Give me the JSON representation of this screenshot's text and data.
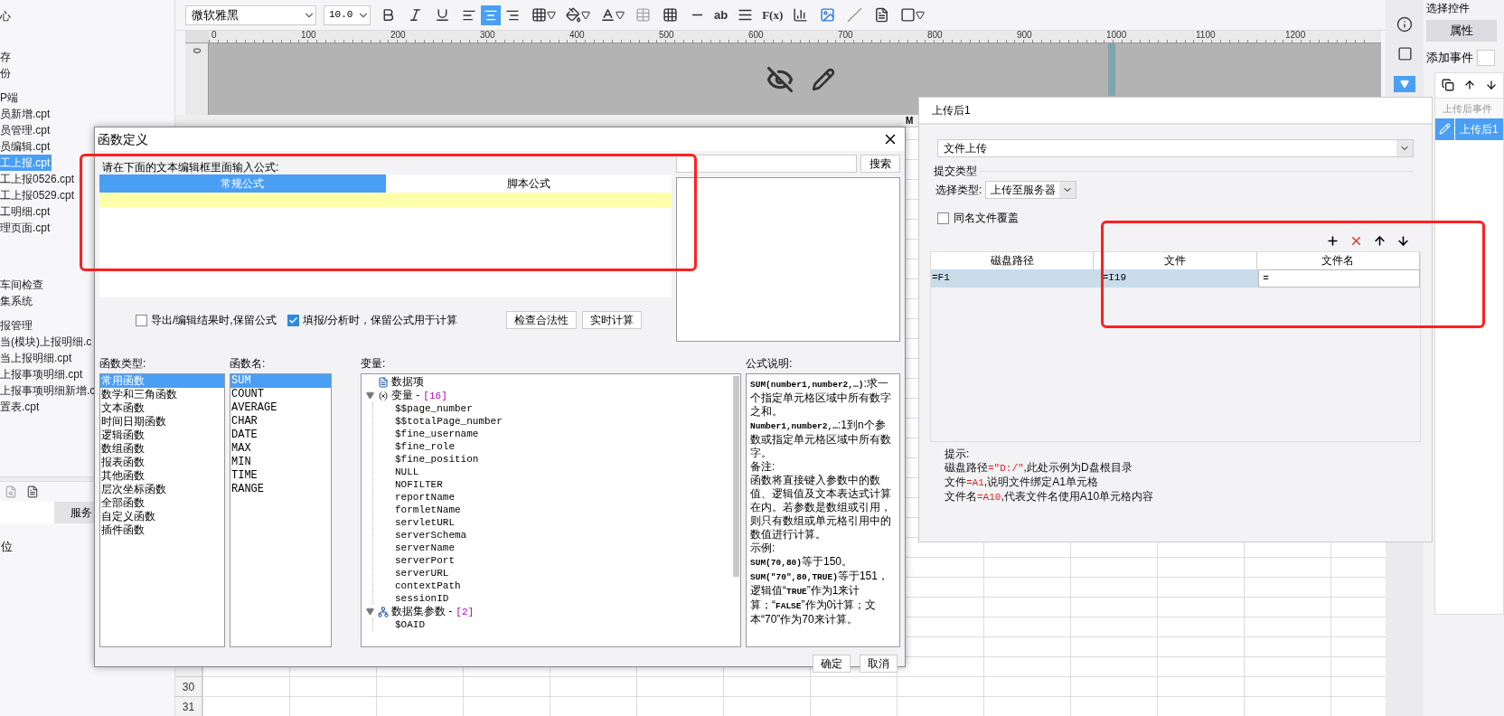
{
  "toolbar": {
    "font": "微软雅黑",
    "size": "10.0",
    "align_buttons": [
      {
        "selected": false
      },
      {
        "selected": true
      },
      {
        "selected": false
      }
    ],
    "text_icon_label": "ab",
    "formula_label": "F(x)"
  },
  "ruler": {
    "vertical_label": "0",
    "labels": [
      "0",
      "100",
      "200",
      "300",
      "400",
      "500",
      "600",
      "700",
      "800",
      "900",
      "1000",
      "1100",
      "1200"
    ]
  },
  "left_panel": {
    "groups": [
      [
        {
          "text": "心",
          "selected": false
        }
      ],
      [
        {
          "text": "存",
          "selected": false
        },
        {
          "text": "份",
          "selected": false
        }
      ],
      [
        {
          "text": "P端",
          "selected": false
        },
        {
          "text": "员新增.cpt",
          "selected": false
        },
        {
          "text": "员管理.cpt",
          "selected": false
        },
        {
          "text": "员编辑.cpt",
          "selected": false
        },
        {
          "text": "工上报.cpt",
          "selected": true
        },
        {
          "text": "工上报0526.cpt",
          "selected": false
        },
        {
          "text": "工上报0529.cpt",
          "selected": false
        },
        {
          "text": "工明细.cpt",
          "selected": false
        },
        {
          "text": "理页面.cpt",
          "selected": false
        }
      ],
      [
        {
          "text": "车间检查",
          "selected": false
        },
        {
          "text": "集系统",
          "selected": false
        }
      ],
      [
        {
          "text": "报管理",
          "selected": false
        },
        {
          "text": "当(模块)上报明细.c",
          "selected": false
        },
        {
          "text": "当上报明细.cpt",
          "selected": false
        },
        {
          "text": "上报事项明细.cpt",
          "selected": false
        },
        {
          "text": "上报事项明细新增.c",
          "selected": false
        },
        {
          "text": "置表.cpt",
          "selected": false
        }
      ]
    ],
    "tab": "服务",
    "bottom_item": "位"
  },
  "grid": {
    "column_label": "M",
    "rows": [
      "30",
      "31"
    ]
  },
  "function_dialog": {
    "title": "函数定义",
    "prompt": "请在下面的文本编辑框里面输入公式:",
    "tabs": [
      {
        "label": "常规公式",
        "selected": true
      },
      {
        "label": "脚本公式",
        "selected": false
      }
    ],
    "search_button": "搜索",
    "options": [
      {
        "label": "导出/编辑结果时,保留公式",
        "checked": false
      },
      {
        "label": "填报/分析时，保留公式用于计算",
        "checked": true
      }
    ],
    "action_buttons": [
      "检查合法性",
      "实时计算"
    ],
    "type_label": "函数类型:",
    "types": [
      {
        "text": "常用函数",
        "selected": true
      },
      {
        "text": "数学和三角函数",
        "selected": false
      },
      {
        "text": "文本函数",
        "selected": false
      },
      {
        "text": "时间日期函数",
        "selected": false
      },
      {
        "text": "逻辑函数",
        "selected": false
      },
      {
        "text": "数组函数",
        "selected": false
      },
      {
        "text": "报表函数",
        "selected": false
      },
      {
        "text": "其他函数",
        "selected": false
      },
      {
        "text": "层次坐标函数",
        "selected": false
      },
      {
        "text": "全部函数",
        "selected": false
      },
      {
        "text": "自定义函数",
        "selected": false
      },
      {
        "text": "插件函数",
        "selected": false
      }
    ],
    "name_label": "函数名:",
    "names": [
      {
        "text": "SUM",
        "selected": true
      },
      {
        "text": "COUNT",
        "selected": false
      },
      {
        "text": "AVERAGE",
        "selected": false
      },
      {
        "text": "CHAR",
        "selected": false
      },
      {
        "text": "DATE",
        "selected": false
      },
      {
        "text": "MAX",
        "selected": false
      },
      {
        "text": "MIN",
        "selected": false
      },
      {
        "text": "TIME",
        "selected": false
      },
      {
        "text": "RANGE",
        "selected": false
      }
    ],
    "var_label": "变量:",
    "variables": [
      {
        "label": "数据项",
        "kind": "item"
      },
      {
        "label": "变量 -",
        "count": "[16]",
        "kind": "group",
        "expanded": true,
        "children": [
          {
            "label": "$$page_number"
          },
          {
            "label": "$$totalPage_number"
          },
          {
            "label": "$fine_username"
          },
          {
            "label": "$fine_role"
          },
          {
            "label": "$fine_position"
          },
          {
            "label": "NULL"
          },
          {
            "label": "NOFILTER"
          },
          {
            "label": "reportName"
          },
          {
            "label": "formletName"
          },
          {
            "label": "servletURL"
          },
          {
            "label": "serverSchema"
          },
          {
            "label": "serverName"
          },
          {
            "label": "serverPort"
          },
          {
            "label": "serverURL"
          },
          {
            "label": "contextPath"
          },
          {
            "label": "sessionID"
          }
        ]
      },
      {
        "label": "数据集参数 -",
        "count": "[2]",
        "kind": "dataset",
        "expanded": true,
        "children": [
          {
            "label": "$OAID"
          }
        ]
      }
    ],
    "desc_label": "公式说明:",
    "description": [
      "**SUM(number1,number2,…)**:求一个指定单元格区域中所有数字之和。",
      "**Number1,number2,…**:1到n个参数或指定单元格区域中所有数字。",
      "备注:",
      "函数将直接键入参数中的数值、逻辑值及文本表达式计算在内。若参数是数组或引用，则只有数组或单元格引用中的数值进行计算。",
      "示例:",
      "**SUM(70,80)**等于150。",
      "**SUM(\"70\",80,TRUE)**等于151，逻辑值“**TRUE**”作为1来计算；“**FALSE**”作为0计算；文本“70”作为70来计算。"
    ],
    "ok": "确定",
    "cancel": "取消"
  },
  "upload_panel": {
    "title": "上传后1",
    "action": "文件上传",
    "section": "提交类型",
    "type_label": "选择类型:",
    "type_value": "上传至服务器",
    "overwrite": {
      "label": "同名文件覆盖",
      "checked": false
    },
    "columns": [
      "磁盘路径",
      "文件",
      "文件名"
    ],
    "rows": [
      {
        "selected": true,
        "cells": [
          {
            "text": "=F1",
            "editing": false
          },
          {
            "text": "=I19",
            "editing": false
          },
          {
            "text": "=",
            "editing": true
          }
        ]
      }
    ],
    "hint_title": "提示:",
    "hints": [
      {
        "parts": [
          {
            "text": "磁盘路径",
            "kind": "plain"
          },
          {
            "text": "=\"D:/\"",
            "kind": "code"
          },
          {
            "text": ",此处示例为D盘根目录",
            "kind": "plain"
          }
        ]
      },
      {
        "parts": [
          {
            "text": "文件",
            "kind": "plain"
          },
          {
            "text": "=A1",
            "kind": "code"
          },
          {
            "text": ",说明文件绑定A1单元格",
            "kind": "plain"
          }
        ]
      },
      {
        "parts": [
          {
            "text": "文件名",
            "kind": "plain"
          },
          {
            "text": "=A10",
            "kind": "code"
          },
          {
            "text": ",代表文件名使用A10单元格内容",
            "kind": "plain"
          }
        ]
      }
    ]
  },
  "right_panel": {
    "top_label": "选择控件",
    "tab": {
      "label": "属性",
      "selected": true
    },
    "add_event": "添加事件",
    "event_header": "上传后事件",
    "events": [
      {
        "label": "上传后1",
        "selected": true
      }
    ]
  }
}
